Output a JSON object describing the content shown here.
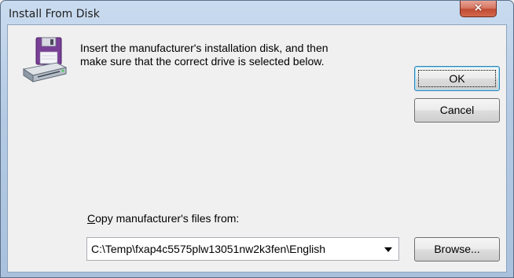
{
  "window": {
    "title": "Install From Disk",
    "close_glyph": "×"
  },
  "message": {
    "line1": "Insert the manufacturer's installation disk, and then",
    "line2": "make sure that the correct drive is selected below."
  },
  "buttons": {
    "ok": "OK",
    "cancel": "Cancel",
    "browse": "Browse..."
  },
  "copy": {
    "label": "Copy manufacturer's files from:",
    "path": "C:\\Temp\\fxap4c5575plw13051nw2k3fen\\English"
  },
  "icons": {
    "disk": "floppy-disk-drive-icon",
    "dropdown": "chevron-down-icon",
    "close": "close-icon"
  },
  "colors": {
    "titlebar": "#b5cbe4",
    "close_button": "#c24b33",
    "floppy": "#7a3f97",
    "focus_border": "#3c7fb1"
  }
}
